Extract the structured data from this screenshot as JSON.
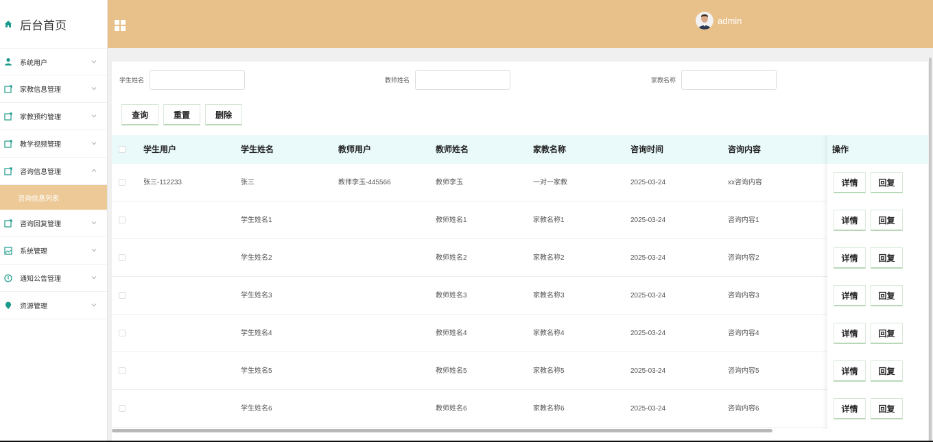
{
  "brand": {
    "title": "后台首页"
  },
  "sidebar": {
    "items": [
      {
        "label": "系统用户",
        "icon": "user-icon"
      },
      {
        "label": "家教信息管理",
        "icon": "doc-icon"
      },
      {
        "label": "家教预约管理",
        "icon": "doc-icon"
      },
      {
        "label": "教学视频管理",
        "icon": "doc-icon"
      },
      {
        "label": "咨询信息管理",
        "icon": "doc-icon",
        "expanded": true
      },
      {
        "label": "咨询回复管理",
        "icon": "doc-icon"
      },
      {
        "label": "系统管理",
        "icon": "image-icon"
      },
      {
        "label": "通知公告管理",
        "icon": "info-icon"
      },
      {
        "label": "资源管理",
        "icon": "location-icon"
      }
    ],
    "sub_item": "咨询信息列表"
  },
  "header": {
    "username": "admin"
  },
  "search": {
    "student_name_label": "学生姓名",
    "teacher_name_label": "教师姓名",
    "tutor_name_label": "家教名称"
  },
  "buttons": {
    "query": "查询",
    "reset": "重置",
    "delete": "删除"
  },
  "table": {
    "headers": [
      "学生用户",
      "学生姓名",
      "教师用户",
      "教师姓名",
      "家教名称",
      "咨询时间",
      "咨询内容",
      "操作"
    ],
    "rows": [
      [
        "张三-112233",
        "张三",
        "教师李玉-445566",
        "教师李玉",
        "一对一家教",
        "2025-03-24",
        "xx咨询内容"
      ],
      [
        "",
        "学生姓名1",
        "",
        "教师姓名1",
        "家教名称1",
        "2025-03-24",
        "咨询内容1"
      ],
      [
        "",
        "学生姓名2",
        "",
        "教师姓名2",
        "家教名称2",
        "2025-03-24",
        "咨询内容2"
      ],
      [
        "",
        "学生姓名3",
        "",
        "教师姓名3",
        "家教名称3",
        "2025-03-24",
        "咨询内容3"
      ],
      [
        "",
        "学生姓名4",
        "",
        "教师姓名4",
        "家教名称4",
        "2025-03-24",
        "咨询内容4"
      ],
      [
        "",
        "学生姓名5",
        "",
        "教师姓名5",
        "家教名称5",
        "2025-03-24",
        "咨询内容5"
      ],
      [
        "",
        "学生姓名6",
        "",
        "教师姓名6",
        "家教名称6",
        "2025-03-24",
        "咨询内容6"
      ]
    ],
    "detail_label": "详情",
    "reply_label": "回复"
  },
  "colors": {
    "header_bg": "#e8c089",
    "active_sub_bg": "#ecc996",
    "table_head_bg": "#eafafa",
    "icon_teal": "#1a9a8a"
  }
}
